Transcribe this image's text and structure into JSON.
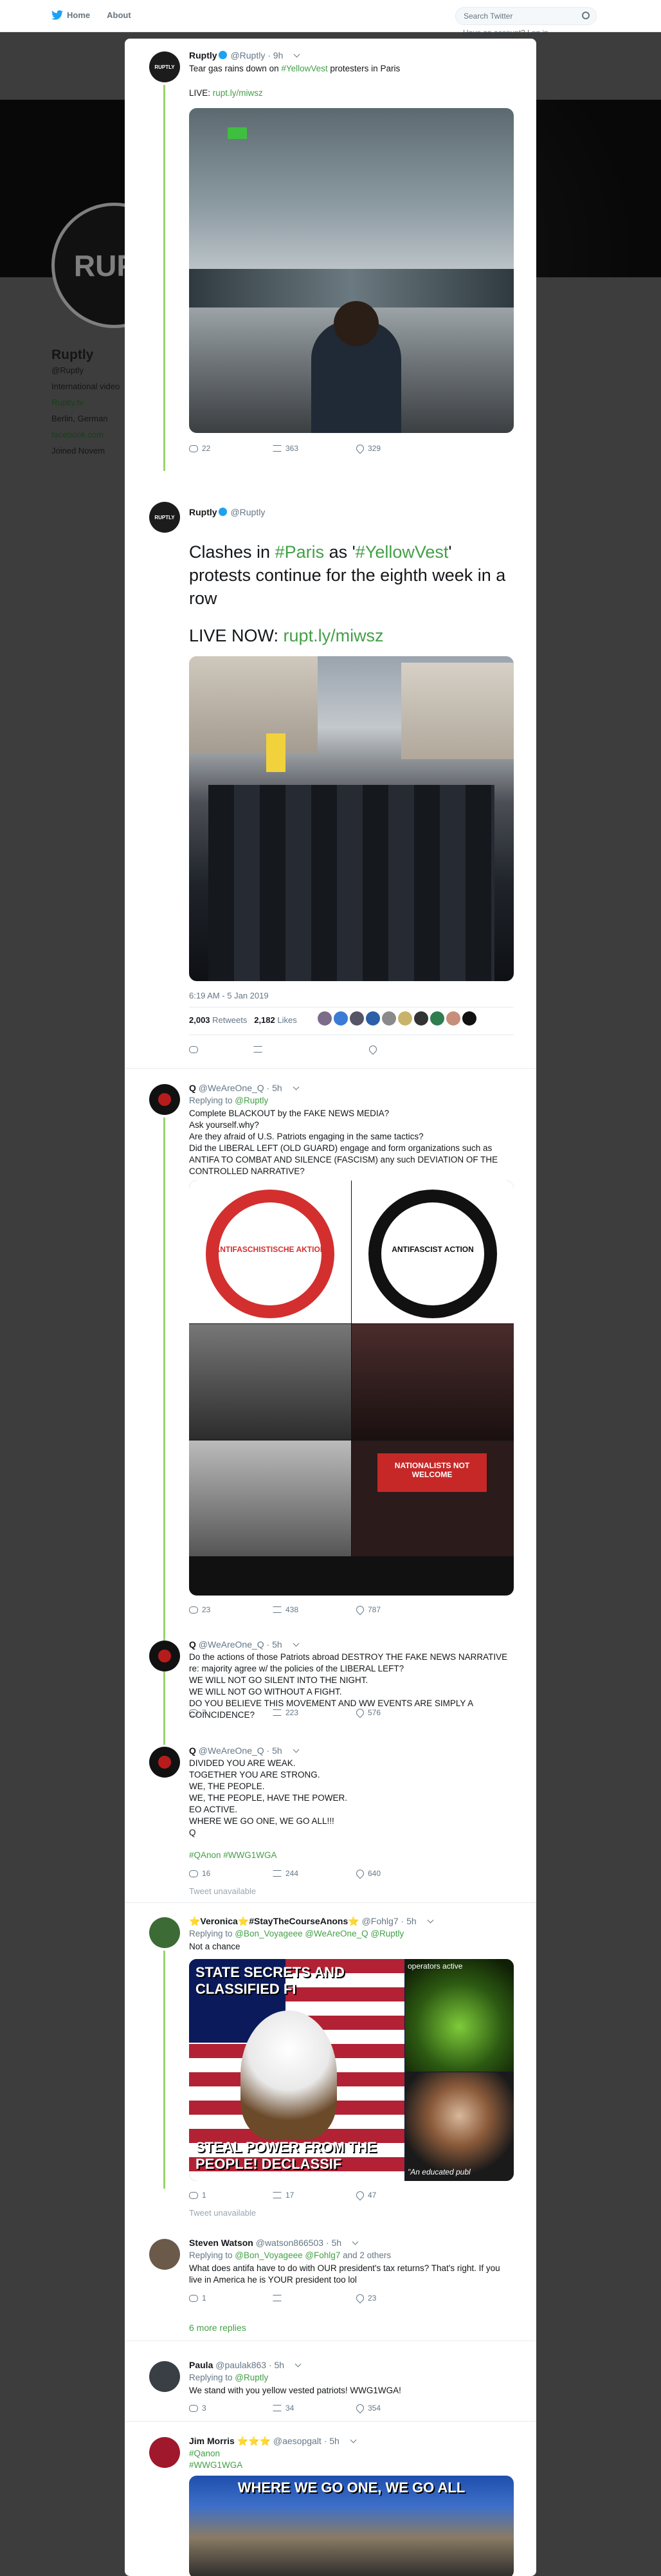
{
  "topbar": {
    "home": "Home",
    "about": "About",
    "search_placeholder": "Search Twitter",
    "login": "Have an account? Log in"
  },
  "close_symbol": "✕",
  "background_profile": {
    "avatar_text": "RUPT",
    "name": "Ruptly",
    "handle": "@Ruptly",
    "bio": "International video",
    "link": "Ruptly.tv",
    "location": "Berlin, German",
    "facebook": "facebook.com",
    "joined": "Joined Novem"
  },
  "tweets": {
    "t1": {
      "avatar": "RUPTLY",
      "name": "Ruptly",
      "handle": "@Ruptly",
      "time": "· 9h",
      "text_a": "Tear gas rains down on ",
      "hashtag": "#YellowVest",
      "text_b": " protesters in Paris",
      "live": "LIVE: ",
      "live_link": "rupt.ly/miwsz",
      "replies": "22",
      "retweets": "363",
      "likes": "329"
    },
    "main": {
      "avatar": "RUPTLY",
      "name": "Ruptly",
      "handle": "@Ruptly",
      "text_a": "Clashes in ",
      "hashtag1": "#Paris",
      "text_b": " as '",
      "hashtag2": "#YellowVest",
      "text_c": "' protests continue for the eighth week in a row",
      "live": "LIVE NOW: ",
      "live_link": "rupt.ly/miwsz",
      "timestamp": "6:19 AM - 5 Jan 2019",
      "retweets_count": "2,003",
      "retweets_label": "Retweets",
      "likes_count": "2,182",
      "likes_label": "Likes"
    },
    "q1": {
      "name": "Q",
      "handle": "@WeAreOne_Q",
      "time": "· 5h",
      "reply_to_label": "Replying to ",
      "reply_to": "@Ruptly",
      "text": "Complete BLACKOUT by the FAKE NEWS MEDIA?\nAsk yourself.why?\nAre they afraid of U.S. Patriots engaging in the same tactics?\nDid the LIBERAL LEFT (OLD GUARD) engage and form organizations such as ANTIFA TO COMBAT AND SILENCE (FASCISM) any such DEVIATION OF THE CONTROLLED NARRATIVE?",
      "antifa1": "ANTIFASCHISTISCHE AKTION",
      "antifa2": "ANTIFASCIST ACTION",
      "sign": "NATIONALISTS NOT WELCOME",
      "replies": "23",
      "retweets": "438",
      "likes": "787"
    },
    "q2": {
      "name": "Q",
      "handle": "@WeAreOne_Q",
      "time": "· 5h",
      "text": "Do the actions of those Patriots abroad DESTROY THE FAKE NEWS NARRATIVE re: majority agree w/ the policies of the LIBERAL LEFT?\nWE WILL NOT GO SILENT INTO THE NIGHT.\nWE WILL NOT GO WITHOUT A FIGHT.\nDO YOU BELIEVE THIS MOVEMENT AND WW EVENTS ARE SIMPLY A COINCIDENCE?",
      "replies": "7",
      "retweets": "223",
      "likes": "576"
    },
    "q3": {
      "name": "Q",
      "handle": "@WeAreOne_Q",
      "time": "· 5h",
      "text": "DIVIDED YOU ARE WEAK.\nTOGETHER YOU ARE STRONG.\nWE, THE PEOPLE.\nWE, THE PEOPLE, HAVE THE POWER.\nEO ACTIVE.\nWHERE WE GO ONE, WE GO ALL!!!\nQ",
      "tags": "#QAnon #WWG1WGA",
      "replies": "16",
      "retweets": "244",
      "likes": "640",
      "unavailable": "Tweet unavailable"
    },
    "v": {
      "name": "⭐Veronica⭐#StayTheCourseAnons⭐",
      "handle": "@Fohlg7",
      "time": "· 5h",
      "reply_to_label": "Replying to ",
      "reply_to": "@Bon_Voyageee @WeAreOne_Q @Ruptly",
      "text": "Not a chance",
      "img_top": "STATE SECRETS AND CLASSIFIED FI",
      "img_bottom": "STEAL POWER FROM THE PEOPLE! DECLASSIF",
      "img_ops": "operators active",
      "img_cap": "\"An educated publ",
      "replies": "1",
      "retweets": "17",
      "likes": "47",
      "unavailable": "Tweet unavailable"
    },
    "sw": {
      "name": "Steven Watson",
      "handle": "@watson866503",
      "time": "· 5h",
      "reply_to_label": "Replying to ",
      "reply_to": "@Bon_Voyageee @Fohlg7",
      "reply_others": " and 2 others",
      "text": "What does antifa have to do with OUR president's tax returns? That's right. If you live in America he is YOUR president too lol",
      "replies": "1",
      "retweets": "",
      "likes": "23",
      "more": "6 more replies"
    },
    "p": {
      "name": "Paula",
      "handle": "@paulak863",
      "time": "· 5h",
      "reply_to_label": "Replying to ",
      "reply_to": "@Ruptly",
      "text": "We stand with you yellow vested patriots! WWG1WGA!",
      "replies": "3",
      "retweets": "34",
      "likes": "354"
    },
    "jm": {
      "name": "Jim Morris",
      "stars": "⭐⭐⭐",
      "handle": "@aesopgalt",
      "time": "· 5h",
      "text": "#Qanon\n#WWG1WGA",
      "img_text": "WHERE WE GO ONE, WE GO ALL"
    }
  }
}
